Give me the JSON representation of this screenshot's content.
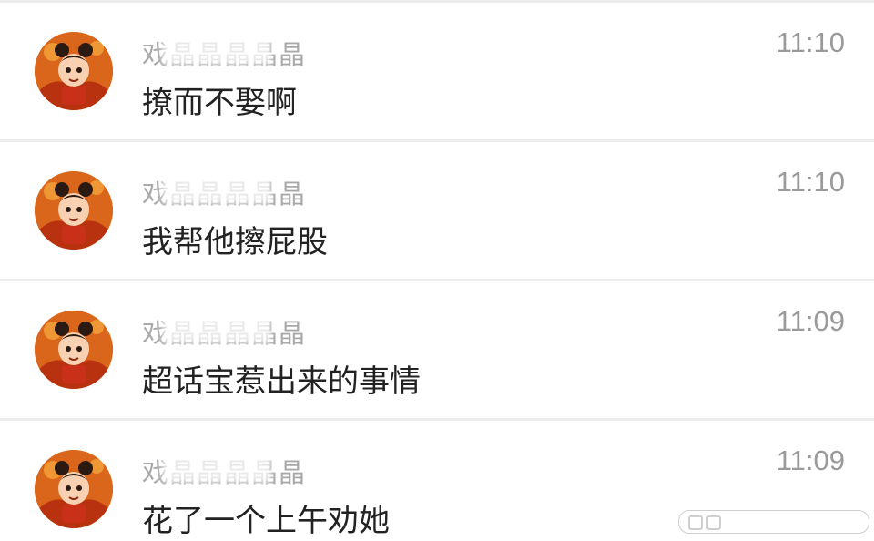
{
  "messages": [
    {
      "sender": "戏晶晶晶晶晶",
      "text": "撩而不娶啊",
      "time": "11:10"
    },
    {
      "sender": "戏晶晶晶晶晶",
      "text": "我帮他擦屁股",
      "time": "11:10"
    },
    {
      "sender": "戏晶晶晶晶晶",
      "text": "超话宝惹出来的事情",
      "time": "11:09"
    },
    {
      "sender": "戏晶晶晶晶晶",
      "text": "花了一个上午劝她",
      "time": "11:09"
    }
  ],
  "avatar_icon": "cartoon-character-avatar",
  "colors": {
    "background": "#ffffff",
    "divider": "#ececec",
    "sender_text": "#a9a9a9",
    "message_text": "#222222",
    "time_text": "#9a9a9a",
    "avatar_bg": "#e2731c"
  }
}
